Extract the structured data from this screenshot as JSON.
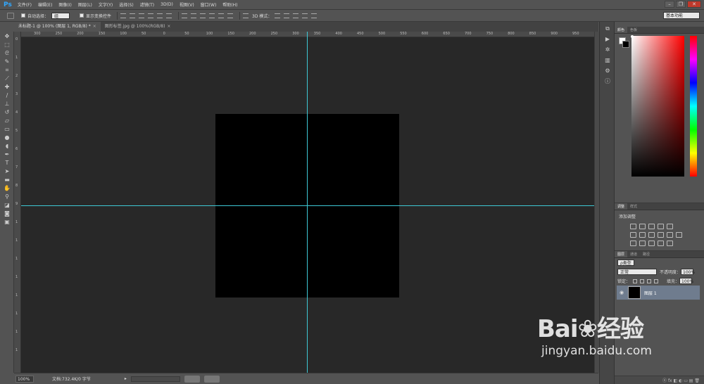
{
  "app": {
    "logo": "Ps"
  },
  "menu": [
    "文件(F)",
    "编辑(E)",
    "图像(I)",
    "图层(L)",
    "文字(Y)",
    "选择(S)",
    "滤镜(T)",
    "3D(D)",
    "视图(V)",
    "窗口(W)",
    "帮助(H)"
  ],
  "window_controls": {
    "minimize": "–",
    "restore": "❐",
    "close": "✕"
  },
  "options": {
    "auto_select_label": "自动选择：",
    "auto_select_value": "组",
    "show_transform_label": "显示变换控件",
    "mode_3d_label": "3D 模式：",
    "workspace": "基本功能"
  },
  "tabs": [
    {
      "label": "未标题-1 @ 100% (图层 1, RGB/8) *",
      "close": "×"
    },
    {
      "label": "图形标签.jpg @ 100%(RGB/8)",
      "close": "×"
    }
  ],
  "ruler_h": [
    "300",
    "250",
    "200",
    "150",
    "100",
    "50",
    "0",
    "50",
    "100",
    "150",
    "200",
    "250",
    "300",
    "350",
    "400",
    "450",
    "500",
    "550",
    "600",
    "650",
    "700",
    "750",
    "800",
    "850",
    "900",
    "950",
    "1000"
  ],
  "ruler_v": [
    "0",
    "1",
    "2",
    "3",
    "4",
    "5",
    "6",
    "7",
    "8",
    "9",
    "1",
    "1",
    "1",
    "1",
    "1",
    "1",
    "1",
    "1"
  ],
  "status": {
    "zoom": "100%",
    "doc_info": "文档:732.4K/0 字节",
    "arrow": "▸"
  },
  "panels": {
    "color_tabs": [
      "颜色",
      "色板"
    ],
    "adjust_tabs": [
      "调整",
      "样式"
    ],
    "adjust_title": "添加调整",
    "layers_tabs": [
      "图层",
      "通道",
      "路径"
    ],
    "kind_label": "ρ类型",
    "blend_mode": "正常",
    "opacity_label": "不透明度：",
    "opacity_value": "100%",
    "lock_label": "锁定：",
    "fill_label": "填充：",
    "fill_value": "100%",
    "layer_name": "图层 1",
    "bottom_icons": "ⓞ fx ◧ ◐ ▭ ▤ 🗑"
  },
  "watermark": {
    "logo": "Bai❀经验",
    "url": "jingyan.baidu.com"
  },
  "colors": {
    "guide": "#3ec9d6",
    "canvas_bg": "#282828",
    "document": "#000000",
    "selected_layer": "#6f7c8e"
  }
}
